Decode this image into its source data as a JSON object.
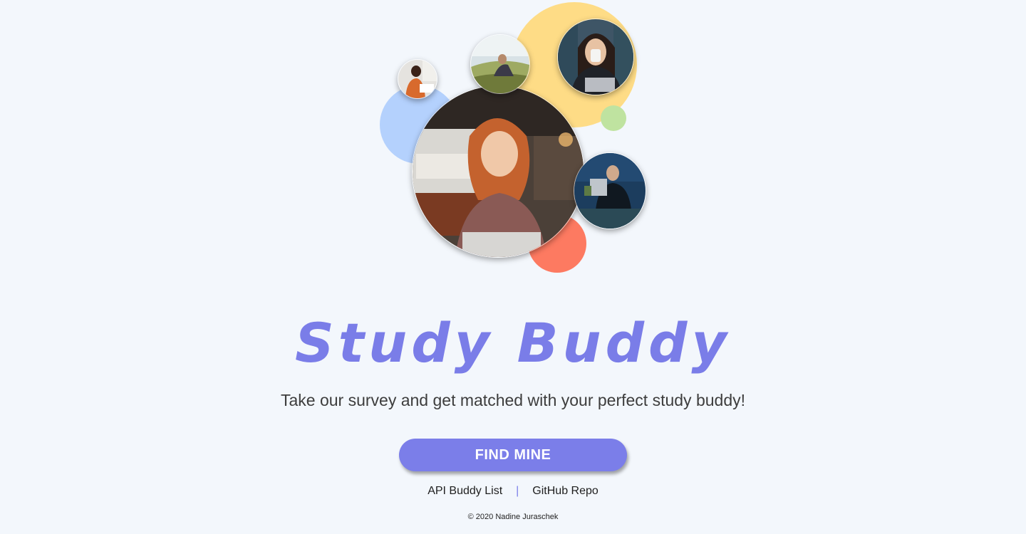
{
  "colors": {
    "background": "#f3f7fc",
    "accent": "#7b7ee9",
    "title": "#7a7de8",
    "blob_yellow": "#fedc86",
    "blob_blue": "#b4d1fd",
    "blob_green": "#bfe3a0",
    "blob_coral": "#fd7a61"
  },
  "hero": {
    "images": [
      {
        "name": "woman-laptop-photo"
      },
      {
        "name": "woman-drinking-coffee-photo"
      },
      {
        "name": "person-reading-outdoors-photo"
      },
      {
        "name": "woman-writing-photo"
      },
      {
        "name": "man-with-laptop-photo"
      }
    ]
  },
  "header": {
    "title": "Study Buddy",
    "subtitle": "Take our survey and get matched with your perfect study buddy!"
  },
  "cta": {
    "label": "FIND MINE"
  },
  "links": {
    "api_label": "API Buddy List",
    "separator": "|",
    "github_label": "GitHub Repo"
  },
  "footer": {
    "copyright": "© 2020 Nadine Juraschek"
  }
}
